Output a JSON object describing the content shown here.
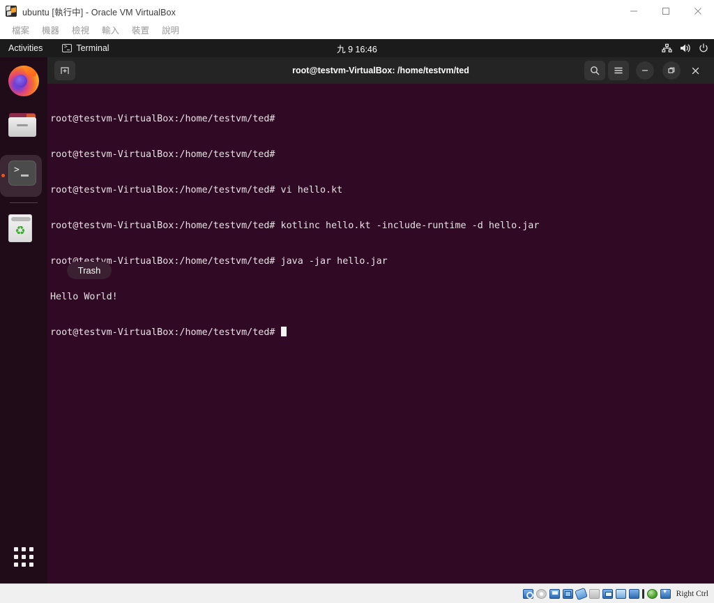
{
  "host_window": {
    "title": "ubuntu [執行中] - Oracle VM VirtualBox",
    "app_icon_name": "virtualbox-icon",
    "menu": [
      {
        "label": "檔案"
      },
      {
        "label": "機器"
      },
      {
        "label": "檢視"
      },
      {
        "label": "輸入"
      },
      {
        "label": "裝置"
      },
      {
        "label": "說明"
      }
    ],
    "window_controls": {
      "minimize": "minimize-icon",
      "maximize": "maximize-icon",
      "close": "close-icon"
    }
  },
  "guest": {
    "topbar": {
      "activities": "Activities",
      "app_name": "Terminal",
      "app_icon": "terminal-icon",
      "clock": "九 9  16:46",
      "tray": [
        {
          "name": "network-icon"
        },
        {
          "name": "volume-icon"
        },
        {
          "name": "power-icon"
        }
      ]
    },
    "dock": {
      "items": [
        {
          "name": "firefox-icon",
          "label": "Firefox",
          "active": false
        },
        {
          "name": "files-icon",
          "label": "Files",
          "active": false
        },
        {
          "name": "terminal-icon",
          "label": "Terminal",
          "active": true
        },
        {
          "name": "trash-icon",
          "label": "Trash",
          "active": false
        }
      ],
      "show_apps": "app-grid-icon"
    },
    "desktop": {
      "trash_label": "Trash"
    },
    "terminal": {
      "title": "root@testvm-VirtualBox: /home/testvm/ted",
      "new_tab_icon": "new-tab-icon",
      "search_icon": "search-icon",
      "menu_icon": "hamburger-menu-icon",
      "minimize_icon": "minimize-icon",
      "restore_icon": "restore-icon",
      "close_icon": "close-icon",
      "background_color": "#300a24",
      "text_color": "#e7e2e4",
      "lines": [
        "root@testvm-VirtualBox:/home/testvm/ted#",
        "root@testvm-VirtualBox:/home/testvm/ted#",
        "root@testvm-VirtualBox:/home/testvm/ted# vi hello.kt",
        "root@testvm-VirtualBox:/home/testvm/ted# kotlinc hello.kt -include-runtime -d hello.jar",
        "root@testvm-VirtualBox:/home/testvm/ted# java -jar hello.jar",
        "Hello World!"
      ],
      "prompt": "root@testvm-VirtualBox:/home/testvm/ted# "
    }
  },
  "statusbar": {
    "icons": [
      {
        "name": "hard-disk-icon"
      },
      {
        "name": "optical-drive-icon"
      },
      {
        "name": "floppy-drive-icon"
      },
      {
        "name": "network-adapter-icon"
      },
      {
        "name": "usb-icon"
      },
      {
        "name": "shared-folders-icon"
      },
      {
        "name": "display-icon"
      },
      {
        "name": "recording-icon"
      },
      {
        "name": "virtualization-icon"
      },
      {
        "name": "mouse-integration-icon"
      },
      {
        "name": "host-key-icon"
      }
    ],
    "host_key": "Right Ctrl"
  }
}
